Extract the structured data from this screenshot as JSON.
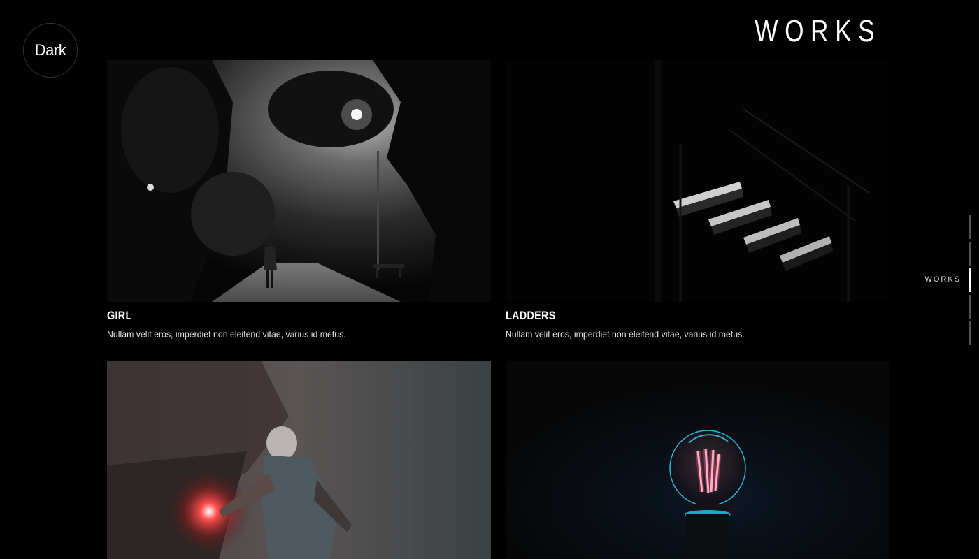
{
  "logo": {
    "label": "Dark"
  },
  "section": {
    "title": "WORKS"
  },
  "works": [
    {
      "name": "GIRL",
      "description": "Nullam velit eros, imperdiet non eleifend vitae, varius id metus."
    },
    {
      "name": "LADDERS",
      "description": "Nullam velit eros, imperdiet non eleifend vitae, varius id metus."
    },
    {
      "name": "",
      "description": ""
    },
    {
      "name": "",
      "description": ""
    }
  ],
  "side_nav": {
    "active_label": "WORKS",
    "active_index": 2,
    "count": 5
  },
  "colors": {
    "background": "#000000",
    "text": "#ffffff",
    "nav_inactive": "#555555"
  }
}
